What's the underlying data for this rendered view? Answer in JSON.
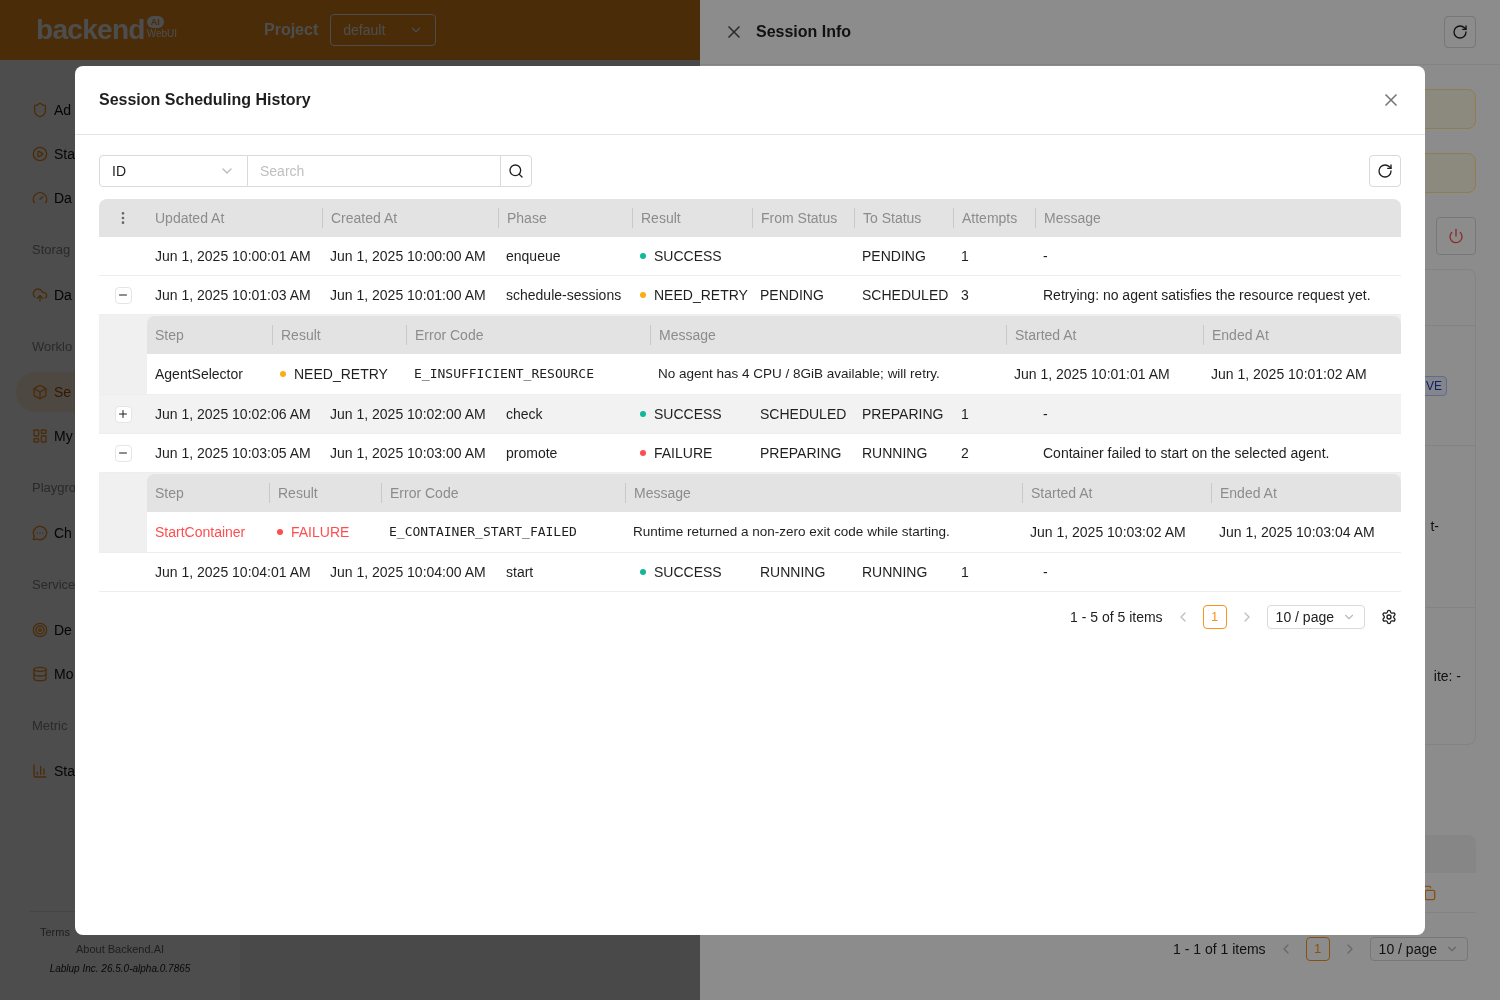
{
  "app": {
    "logo": {
      "word": "backend",
      "badge": "AI",
      "sub": "WebUI"
    },
    "project": {
      "label": "Project",
      "value": "default"
    },
    "sidebar": [
      {
        "kind": "item",
        "label": "Ad",
        "selected": false
      },
      {
        "kind": "item",
        "label": "Sta",
        "selected": false
      },
      {
        "kind": "item",
        "label": "Da",
        "selected": false
      },
      {
        "kind": "group",
        "label": "Storag"
      },
      {
        "kind": "item",
        "label": "Da",
        "selected": false
      },
      {
        "kind": "group",
        "label": "Worklo"
      },
      {
        "kind": "item",
        "label": "Se",
        "selected": true
      },
      {
        "kind": "item",
        "label": "My",
        "selected": false
      },
      {
        "kind": "group",
        "label": "Playgro"
      },
      {
        "kind": "item",
        "label": "Ch",
        "selected": false
      },
      {
        "kind": "group",
        "label": "Service"
      },
      {
        "kind": "item",
        "label": "De",
        "selected": false
      },
      {
        "kind": "item",
        "label": "Mo",
        "selected": false
      },
      {
        "kind": "group",
        "label": "Metric"
      },
      {
        "kind": "item",
        "label": "Sta",
        "selected": false
      }
    ],
    "footer": {
      "terms": "Terms",
      "about": "About Backend.AI",
      "version": "Lablup Inc. 26.5.0-alpha.0.7865"
    }
  },
  "drawer": {
    "title": "Session Info",
    "tag": "VE",
    "values": [
      "t-",
      "ite: -"
    ],
    "pagination": {
      "summary": "1 - 1 of 1 items",
      "pages": [
        {
          "label": "1",
          "selected": true
        }
      ],
      "page_size": "10 / page"
    }
  },
  "dialog": {
    "title": "Session Scheduling History",
    "filter": {
      "field": "ID",
      "placeholder": "Search"
    },
    "columns": [
      "Updated At",
      "Created At",
      "Phase",
      "Result",
      "From Status",
      "To Status",
      "Attempts",
      "Message"
    ],
    "rows": [
      {
        "kind": "plain",
        "highlighted": false,
        "updated_at": "Jun 1, 2025 10:00:01 AM",
        "created_at": "Jun 1, 2025 10:00:00 AM",
        "phase": "enqueue",
        "result": {
          "label": "SUCCESS",
          "color": "#13b795"
        },
        "to_status": "PENDING",
        "attempts": "1",
        "message": "-"
      },
      {
        "kind": "expandable",
        "expanded": true,
        "highlighted": false,
        "updated_at": "Jun 1, 2025 10:01:03 AM",
        "created_at": "Jun 1, 2025 10:01:00 AM",
        "phase": "schedule-sessions",
        "result": {
          "label": "NEED_RETRY",
          "color": "#faad14"
        },
        "from_status": "PENDING",
        "to_status": "SCHEDULED",
        "attempts": "3",
        "message": "Retrying: no agent satisfies the resource request yet.",
        "steps": {
          "columns": [
            "Step",
            "Result",
            "Error Code",
            "Message",
            "Started At",
            "Ended At"
          ],
          "rows": [
            {
              "step": "AgentSelector",
              "failed": false,
              "result": {
                "label": "NEED_RETRY",
                "color": "#faad14"
              },
              "error_code": "E_INSUFFICIENT_RESOURCE",
              "message": "No agent has 4 CPU / 8GiB available; will retry.",
              "started_at": "Jun 1, 2025 10:01:01 AM",
              "ended_at": "Jun 1, 2025 10:01:02 AM"
            }
          ]
        }
      },
      {
        "kind": "expandable",
        "expanded": false,
        "highlighted": true,
        "updated_at": "Jun 1, 2025 10:02:06 AM",
        "created_at": "Jun 1, 2025 10:02:00 AM",
        "phase": "check",
        "result": {
          "label": "SUCCESS",
          "color": "#13b795"
        },
        "from_status": "SCHEDULED",
        "to_status": "PREPARING",
        "attempts": "1",
        "message": "-"
      },
      {
        "kind": "expandable",
        "expanded": true,
        "highlighted": false,
        "updated_at": "Jun 1, 2025 10:03:05 AM",
        "created_at": "Jun 1, 2025 10:03:00 AM",
        "phase": "promote",
        "result": {
          "label": "FAILURE",
          "color": "#ff4d4f"
        },
        "from_status": "PREPARING",
        "to_status": "RUNNING",
        "attempts": "2",
        "message": "Container failed to start on the selected agent.",
        "steps": {
          "columns": [
            "Step",
            "Result",
            "Error Code",
            "Message",
            "Started At",
            "Ended At"
          ],
          "rows": [
            {
              "step": "StartContainer",
              "failed": true,
              "result": {
                "label": "FAILURE",
                "color": "#ff4d4f"
              },
              "error_code": "E_CONTAINER_START_FAILED",
              "message": "Runtime returned a non-zero exit code while starting.",
              "started_at": "Jun 1, 2025 10:03:02 AM",
              "ended_at": "Jun 1, 2025 10:03:04 AM"
            }
          ]
        }
      },
      {
        "kind": "plain",
        "highlighted": false,
        "updated_at": "Jun 1, 2025 10:04:01 AM",
        "created_at": "Jun 1, 2025 10:04:00 AM",
        "phase": "start",
        "result": {
          "label": "SUCCESS",
          "color": "#13b795"
        },
        "from_status": "RUNNING",
        "to_status": "RUNNING",
        "attempts": "1",
        "message": "-"
      }
    ],
    "pagination": {
      "summary": "1 - 5 of 5 items",
      "pages": [
        {
          "label": "1",
          "selected": true
        }
      ],
      "page_size": "10 / page"
    }
  }
}
